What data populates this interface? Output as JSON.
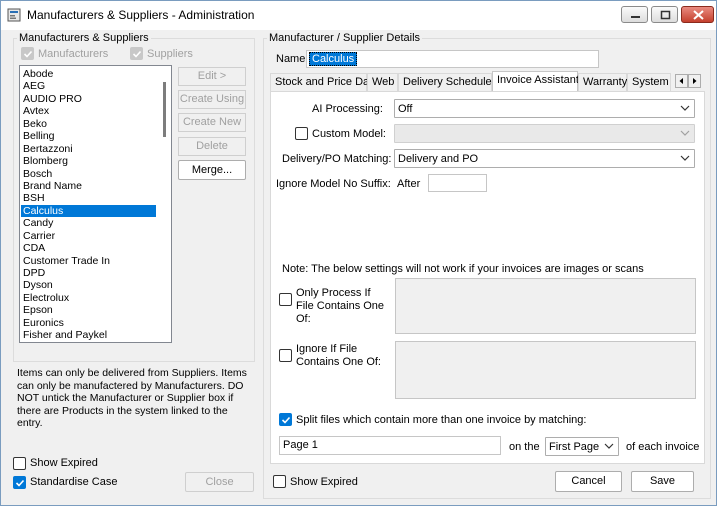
{
  "window": {
    "title": "Manufacturers & Suppliers - Administration"
  },
  "left": {
    "group_title": "Manufacturers & Suppliers",
    "filter_manufacturers": "Manufacturers",
    "filter_suppliers": "Suppliers",
    "items": [
      "Abode",
      "AEG",
      "AUDIO PRO",
      "Avtex",
      "Beko",
      "Belling",
      "Bertazzoni",
      "Blomberg",
      "Bosch",
      "Brand Name",
      "BSH",
      "Calculus",
      "Candy",
      "Carrier",
      "CDA",
      "Customer Trade In",
      "DPD",
      "Dyson",
      "Electrolux",
      "Epson",
      "Euronics",
      "Fisher and Paykel"
    ],
    "selected_item": "Calculus",
    "buttons": {
      "edit": "Edit >",
      "create_using": "Create Using",
      "create_new": "Create New",
      "delete": "Delete",
      "merge": "Merge..."
    },
    "note": "Items can only be delivered from Suppliers. Items can only be manufactered by Manufacturers. DO NOT untick the Manufacturer or Supplier box if there are Products in the system linked to the entry.",
    "show_expired": "Show Expired",
    "standardise_case": "Standardise Case",
    "close": "Close"
  },
  "right": {
    "group_title": "Manufacturer / Supplier Details",
    "name_label": "Name:",
    "name_value": "Calculus",
    "tabs": [
      "Stock and Price Data",
      "Web",
      "Delivery Schedule",
      "Invoice Assistant",
      "Warranty",
      "System"
    ],
    "active_tab": "Invoice Assistant",
    "ai_processing_label": "AI Processing:",
    "ai_processing_value": "Off",
    "custom_model_label": "Custom Model:",
    "custom_model_value": "",
    "delivery_po_label": "Delivery/PO Matching:",
    "delivery_po_value": "Delivery and PO",
    "ignore_model_label": "Ignore Model No Suffix:",
    "after_label": "After",
    "after_value": "",
    "images_note": "Note: The below settings will not work if your invoices are images or scans",
    "only_process_label": "Only Process If File Contains One Of:",
    "ignore_if_label": "Ignore If File Contains One Of:",
    "split_label": "Split files which contain more than one invoice by matching:",
    "split_value": "Page 1",
    "on_the_label": "on the",
    "position_value": "First Page",
    "each_invoice_label": "of each invoice",
    "show_expired": "Show Expired",
    "cancel": "Cancel",
    "save": "Save"
  },
  "icons": {
    "app": "app-icon",
    "minimize": "minimize-icon",
    "maximize": "maximize-icon",
    "close": "close-icon",
    "dropdown": "chevron-down-icon",
    "checkmark": "checkmark-icon",
    "tab_left": "arrow-left-icon",
    "tab_right": "arrow-right-icon"
  },
  "colors": {
    "accent": "#0078d7",
    "window_bg": "#f0f0f0",
    "close_button": "#c4402d"
  }
}
